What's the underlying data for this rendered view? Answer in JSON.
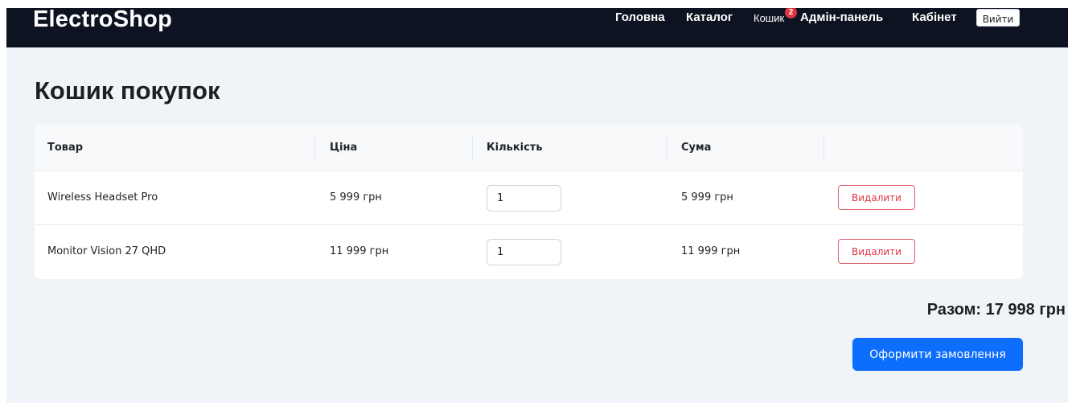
{
  "navbar": {
    "brand": "ElectroShop",
    "links": {
      "home": "Головна",
      "catalog": "Каталог",
      "cart": "Кошик",
      "admin": "Адмін-панель",
      "cabinet": "Кабінет"
    },
    "cart_badge": "2",
    "logout_label": "Вийти"
  },
  "page": {
    "title": "Кошик покупок"
  },
  "cart": {
    "columns": [
      "Товар",
      "Ціна",
      "Кількість",
      "Сума",
      ""
    ],
    "rows": [
      {
        "product": "Wireless Headset Pro",
        "price": "5 999 грн",
        "quantity": "1",
        "sum": "5 999 грн",
        "remove_label": "Видалити"
      },
      {
        "product": "Monitor Vision 27 QHD",
        "price": "11 999 грн",
        "quantity": "1",
        "sum": "11 999 грн",
        "remove_label": "Видалити"
      }
    ]
  },
  "summary": {
    "total": "Разом: 17 998 грн",
    "checkout_label": "Оформити замовлення"
  },
  "colors": {
    "navbar_bg": "#0d1321",
    "page_bg": "#f0f4f9",
    "primary": "#0d6efd",
    "danger": "#dc3545",
    "badge": "#e0343f"
  }
}
